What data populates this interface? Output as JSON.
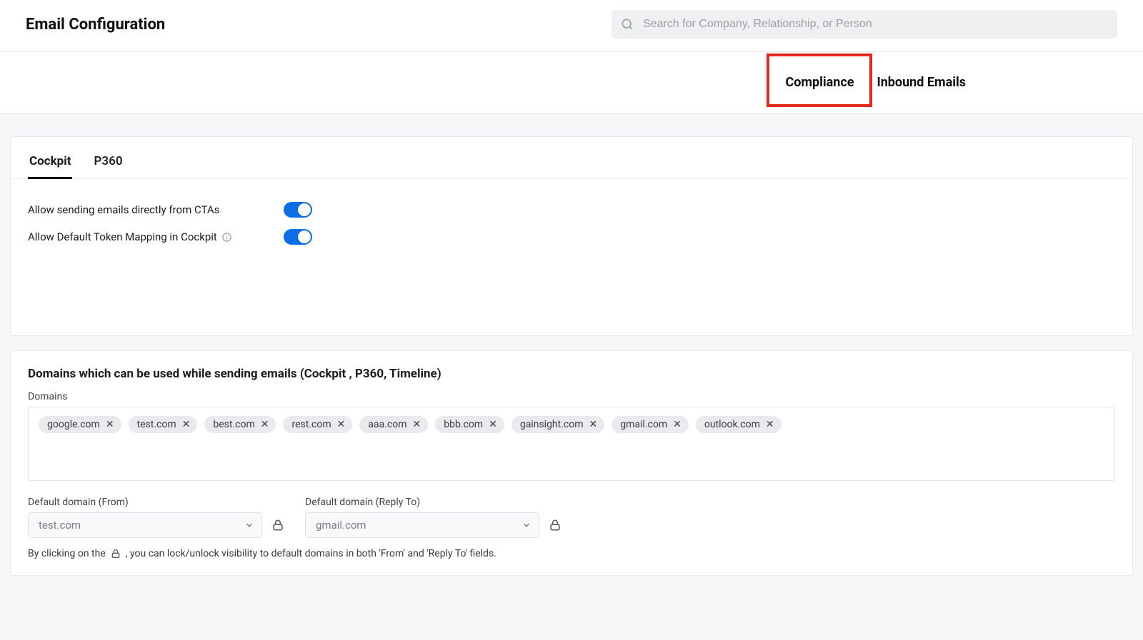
{
  "header": {
    "title": "Email Configuration",
    "search_placeholder": "Search for Company, Relationship, or Person"
  },
  "top_tabs": {
    "compliance": "Compliance",
    "inbound": "Inbound Emails",
    "highlighted": "compliance"
  },
  "inner_tabs": {
    "cockpit": "Cockpit",
    "p360": "P360",
    "active": "cockpit"
  },
  "settings": {
    "row1_label": "Allow sending emails directly from CTAs",
    "row1_on": true,
    "row2_label": "Allow Default Token Mapping in Cockpit",
    "row2_on": true
  },
  "domains": {
    "section_title": "Domains which can be used while sending emails (Cockpit , P360, Timeline)",
    "field_label": "Domains",
    "chips": [
      "google.com",
      "test.com",
      "best.com",
      "rest.com",
      "aaa.com",
      "bbb.com",
      "gainsight.com",
      "gmail.com",
      "outlook.com"
    ],
    "from_label": "Default domain (From)",
    "from_value": "test.com",
    "replyto_label": "Default domain (Reply To)",
    "replyto_value": "gmail.com",
    "note_prefix": "By clicking on the ",
    "note_suffix": ", you can lock/unlock visibility to default domains in both 'From' and 'Reply To' fields."
  }
}
